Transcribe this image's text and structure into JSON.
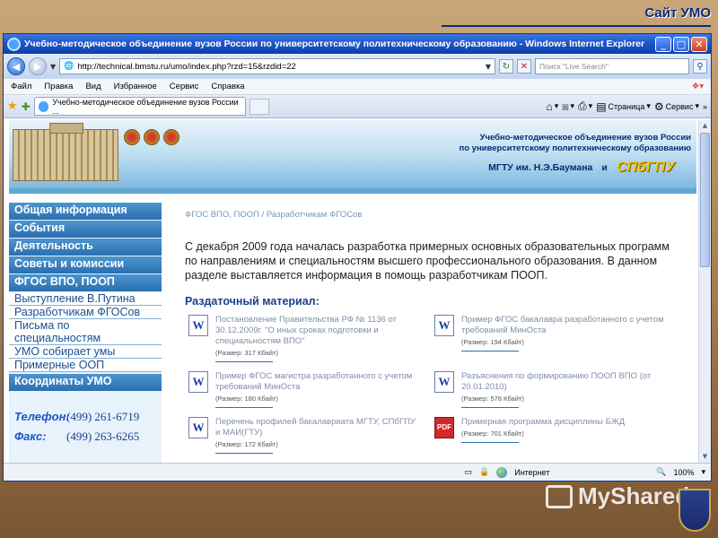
{
  "slide": {
    "title": "Сайт УМО"
  },
  "window": {
    "title": "Учебно-методическое объединение вузов России по университетскому политехническому образованию - Windows Internet Explorer",
    "controls": {
      "minimize": "_",
      "maximize": "□",
      "close": "✕"
    }
  },
  "address": {
    "url": "http://technical.bmstu.ru/umo/index.php?rzd=15&rzdid=22",
    "search_placeholder": "Поиск \"Live Search\""
  },
  "menu": [
    "Файл",
    "Правка",
    "Вид",
    "Избранное",
    "Сервис",
    "Справка"
  ],
  "tab": {
    "label": "Учебно-методическое объединение вузов России ..."
  },
  "toolbar": {
    "page": "Страница",
    "tools": "Сервис"
  },
  "banner": {
    "line1": "Учебно-методическое объединение вузов России",
    "line2": "по университетскому политехническому образованию",
    "bmstu": "МГТУ им. Н.Э.Баумана",
    "and": "и",
    "spbgtu": "СПбГПУ"
  },
  "nav": {
    "main_top": [
      {
        "label": "Общая информация"
      },
      {
        "label": "События"
      },
      {
        "label": "Деятельность"
      },
      {
        "label": "Советы и комиссии"
      },
      {
        "label": "ФГОС ВПО, ПООП"
      }
    ],
    "sub": [
      {
        "label": "Выступление В.Путина"
      },
      {
        "label": "Разработчикам ФГОСов"
      },
      {
        "label": "Письма по специальностям"
      },
      {
        "label": "УМО собирает умы"
      },
      {
        "label": "Примерные ООП"
      }
    ],
    "main_bottom": [
      {
        "label": "Координаты УМО"
      }
    ],
    "contacts": {
      "phone_label": "Телефон:",
      "phone": "(499) 261-6719",
      "fax_label": "Факс:",
      "fax": "(499) 263-6265"
    }
  },
  "main": {
    "breadcrumb": "ФГОС ВПО, ПООП / Разработчикам ФГОСов",
    "intro": "С декабря 2009 года началась разработка примерных основных образовательных программ по направлениям и специальностям высшего профессионального образования. В данном разделе выставляется информация в помощь разработчикам ПООП.",
    "handout": "Раздаточный материал:",
    "docs": [
      {
        "title": "Постановление Правительства РФ № 1136 от 30.12.2009г. \"О иных сроках подготовки и специальностям ВПО\"",
        "size": "(Размер: 317 Кбайт)",
        "type": "word"
      },
      {
        "title": "Пример ФГОС бакалавра разработанного с учетом требований МинОста",
        "size": "(Размер: 194 Кбайт)",
        "type": "word"
      },
      {
        "title": "Пример ФГОС магистра разработанного с учетом требований МинОста",
        "size": "(Размер: 180 Кбайт)",
        "type": "word"
      },
      {
        "title": "Разъяснения по формированию ПООП ВПО (от 20.01.2010)",
        "size": "(Размер: 578 Кбайт)",
        "type": "word"
      },
      {
        "title": "Перечень профилей бакалавриата МГТУ, СПбГПУ и МАИ(ГТУ)",
        "size": "(Размер: 172 Кбайт)",
        "type": "word"
      },
      {
        "title": "Примерная программа дисциплины БЖД",
        "size": "(Размер: 701 Кбайт)",
        "type": "pdf"
      }
    ]
  },
  "status": {
    "zone": "Интернет",
    "zoom": "100%"
  },
  "watermark": {
    "text": "MyShared"
  }
}
